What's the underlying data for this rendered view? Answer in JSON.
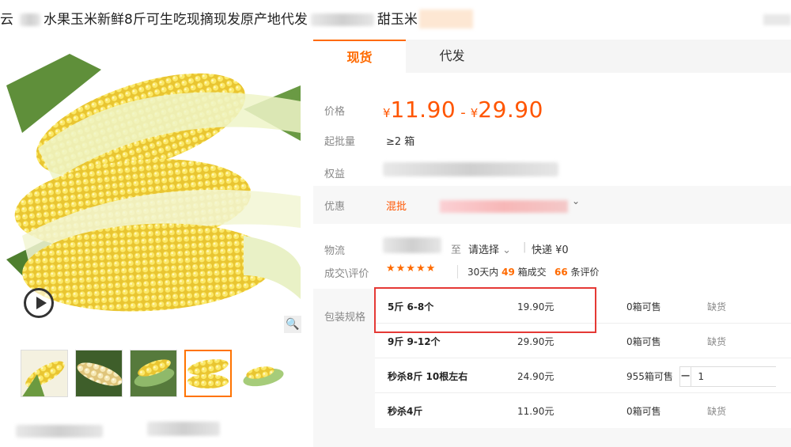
{
  "header": {
    "title_part1": "云",
    "title_part2": "水果玉米新鲜8斤可生吃现摘现发原产地代发",
    "title_part3": "甜玉米"
  },
  "tabs": [
    "现货",
    "代发"
  ],
  "labels": {
    "price": "价格",
    "min_order": "起批量",
    "benefits": "权益",
    "promo": "优惠",
    "logistics": "物流",
    "deals": "成交\\评价",
    "spec": "包装规格"
  },
  "price": {
    "currency": "¥",
    "low": "11.90",
    "high": "29.90",
    "separator": "-"
  },
  "min_order_value": "≥2 箱",
  "promo_text": "混批",
  "promo_caret": "⌄",
  "logistics": {
    "to": "至",
    "select": "请选择",
    "caret": "⌄",
    "separator": "|",
    "shipping": "快递 ¥0"
  },
  "rating": {
    "stars": "★★★★★",
    "deal_prefix": "30天内",
    "deal_count": "49",
    "deal_suffix": "箱成交",
    "review_count": "66",
    "review_suffix": "条评价"
  },
  "specs": [
    {
      "name": "5斤 6-8个",
      "price": "19.90元",
      "stock": "0箱可售",
      "status": "缺货"
    },
    {
      "name": "9斤 9-12个",
      "price": "29.90元",
      "stock": "0箱可售",
      "status": "缺货"
    },
    {
      "name": "秒杀8斤 10根左右",
      "price": "24.90元",
      "stock": "955箱可售",
      "status": ""
    },
    {
      "name": "秒杀4斤",
      "price": "11.90元",
      "stock": "0箱可售",
      "status": "缺货"
    }
  ],
  "stepper": {
    "minus": "−",
    "plus": "+",
    "value": "1"
  },
  "icons": {
    "zoom": "🔍",
    "play": "play-icon"
  },
  "colors": {
    "accent": "#ff6a00",
    "price": "#ff5500",
    "highlight": "#e53935"
  }
}
